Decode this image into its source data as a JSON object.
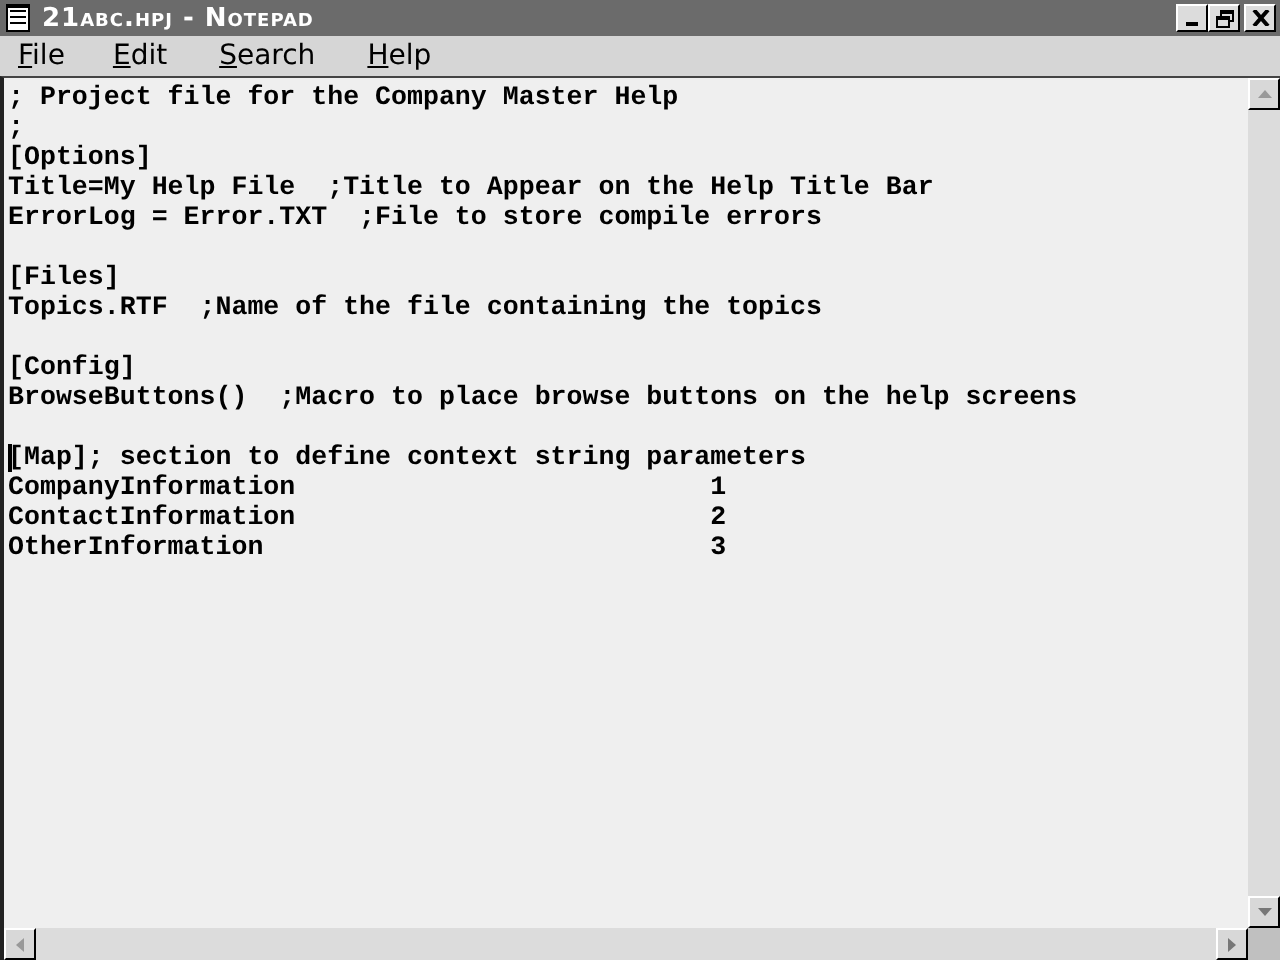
{
  "window": {
    "title": "21abc.hpj - Notepad"
  },
  "menu": [
    "File",
    "Edit",
    "Search",
    "Help"
  ],
  "document": {
    "blocks": [
      {
        "lines": [
          {
            "text": "; Project file for the Company Master Help",
            "cursor": false
          },
          {
            "text": ";",
            "cursor": false
          },
          {
            "text": "[Options]",
            "cursor": false
          },
          {
            "text": "Title=My Help File  ;Title to Appear on the Help Title Bar",
            "cursor": false
          },
          {
            "text": "ErrorLog = Error.TXT  ;File to store compile errors",
            "cursor": false
          }
        ]
      },
      {
        "lines": [
          {
            "text": "[Files]",
            "cursor": false
          },
          {
            "text": "Topics.RTF  ;Name of the file containing the topics",
            "cursor": false
          }
        ]
      },
      {
        "lines": [
          {
            "text": "[Config]",
            "cursor": false
          },
          {
            "text": "BrowseButtons()  ;Macro to place browse buttons on the help screens",
            "cursor": false
          }
        ]
      },
      {
        "lines": [
          {
            "text": "[Map]; section to define context string parameters",
            "cursor": true
          },
          {
            "text": "CompanyInformation                          1",
            "cursor": false
          },
          {
            "text": "ContactInformation                          2",
            "cursor": false
          },
          {
            "text": "OtherInformation                            3",
            "cursor": false
          }
        ]
      }
    ]
  }
}
